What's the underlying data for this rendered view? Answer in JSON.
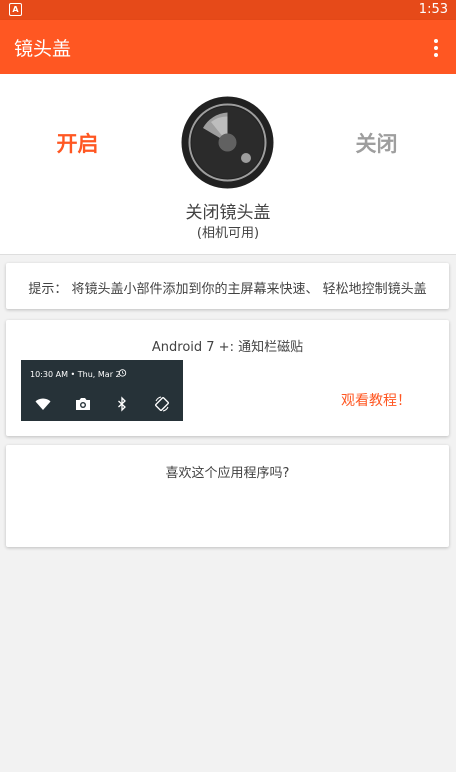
{
  "status_bar": {
    "notification_glyph": "A",
    "time": "1:53"
  },
  "app_bar": {
    "title": "镜头盖",
    "menu_icon": "more-vert-icon"
  },
  "hero": {
    "on_label": "开启",
    "off_label": "关闭",
    "status_label": "关闭镜头盖",
    "status_sub": "(相机可用)",
    "lens_icon": "camera-lens-icon"
  },
  "tip": {
    "text": "提示： 将镜头盖小部件添加到你的主屏幕来快速、 轻松地控制镜头盖"
  },
  "tile": {
    "title": "Android 7 +: 通知栏磁贴",
    "preview_time": "10:30 AM • Thu, Mar 2",
    "tutorial_label": "观看教程！"
  },
  "rate": {
    "question": "喜欢这个应用程序吗?"
  },
  "colors": {
    "accent": "#ff5722",
    "status_bar": "#e64a19",
    "inactive": "#9e9e9e",
    "preview_bg": "#263238"
  }
}
